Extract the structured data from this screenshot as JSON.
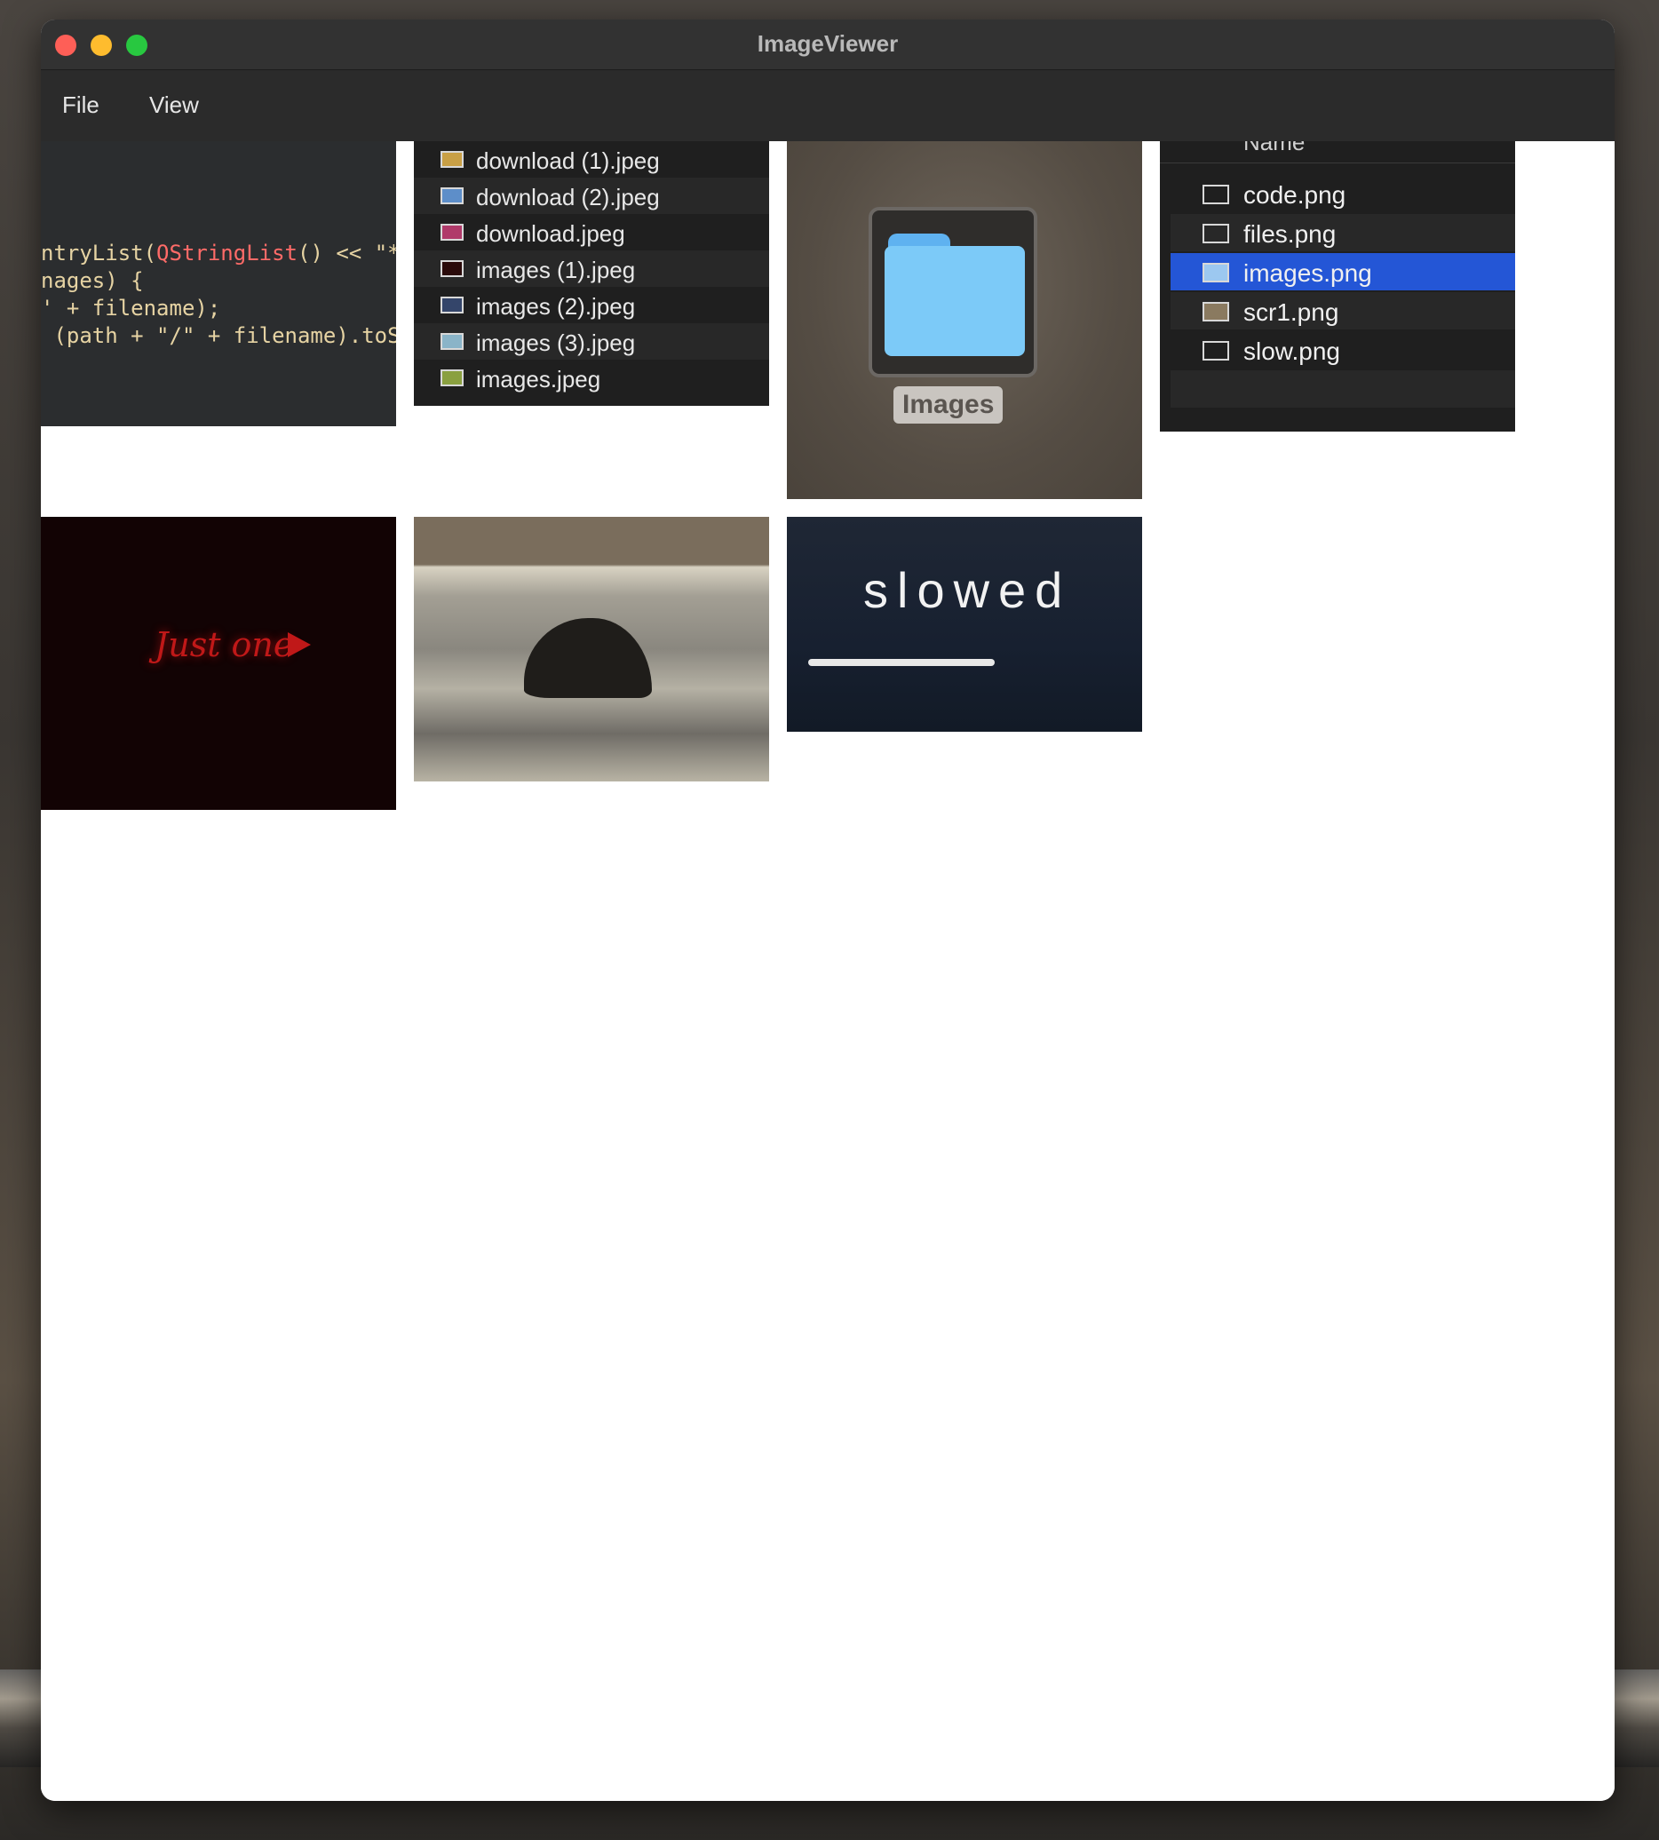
{
  "window": {
    "title": "ImageViewer"
  },
  "menu": {
    "file": "File",
    "view": "View"
  },
  "thumbnails": {
    "code": {
      "lines": [
        {
          "pre": "ntryList(",
          "type": "QStringList",
          "post": "() << \"*."
        },
        {
          "pre": "nages) {",
          "type": "",
          "post": ""
        },
        {
          "pre": "' + filename);",
          "type": "",
          "post": ""
        },
        {
          "pre": " (path + \"/\" + filename).toSt",
          "type": "",
          "post": ""
        }
      ]
    },
    "files": {
      "items": [
        "download (1).jpeg",
        "download (2).jpeg",
        "download.jpeg",
        "images (1).jpeg",
        "images (2).jpeg",
        "images (3).jpeg",
        "images.jpeg"
      ]
    },
    "folder": {
      "label": "Images"
    },
    "names": {
      "header": "Name",
      "items": [
        "code.png",
        "files.png",
        "images.png",
        "scr1.png",
        "slow.png"
      ],
      "selected": "images.png",
      "selection_color": "#2456d6"
    },
    "just_one": {
      "text": "Just one"
    },
    "slowed": {
      "text": "slowed"
    }
  }
}
